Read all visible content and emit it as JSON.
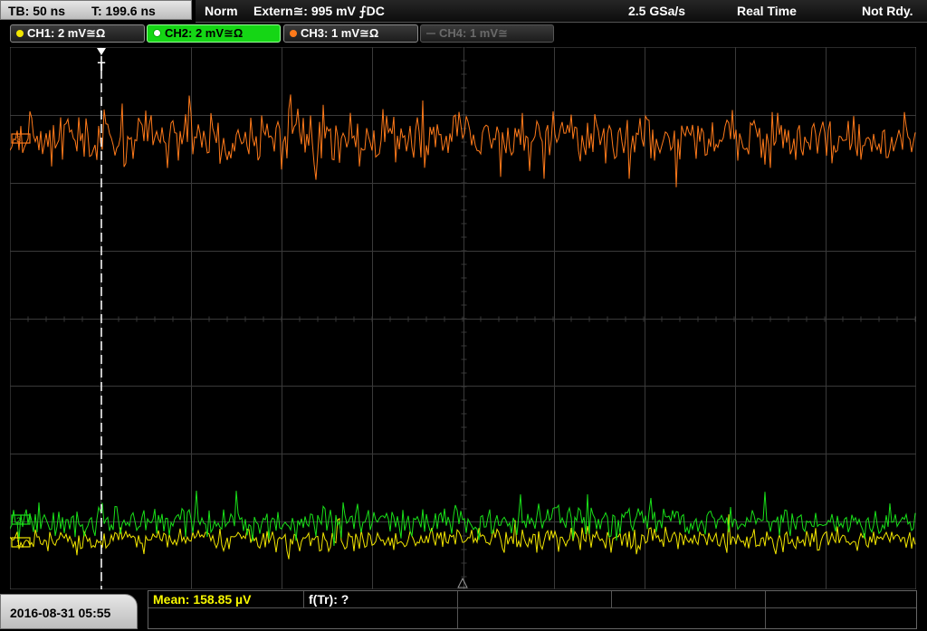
{
  "topbar": {
    "timebase": "TB: 50 ns",
    "trigger_time": "T: 199.6 ns",
    "mode": "Norm",
    "trigger_source": "Extern≅: 995 mV ⨍DC",
    "sample_rate": "2.5 GSa/s",
    "acq_mode": "Real Time",
    "status": "Not Rdy."
  },
  "channels": [
    {
      "label": "CH1: 2 mV≅Ω",
      "color": "#f2e600"
    },
    {
      "label": "CH2: 2 mV≅Ω",
      "color": "#19e019"
    },
    {
      "label": "CH3: 1 mV≅Ω",
      "color": "#ff7a1a"
    },
    {
      "label": "CH4: 1 mV≅",
      "color": "#6a6a6a"
    }
  ],
  "screen": {
    "trigger_marker": "T",
    "grid_color": "#3a3a3a"
  },
  "bottom": {
    "datetime": "2016-08-31 05:55",
    "mean": "Mean: 158.85 µV",
    "freq": "f(Tr): ?"
  }
}
